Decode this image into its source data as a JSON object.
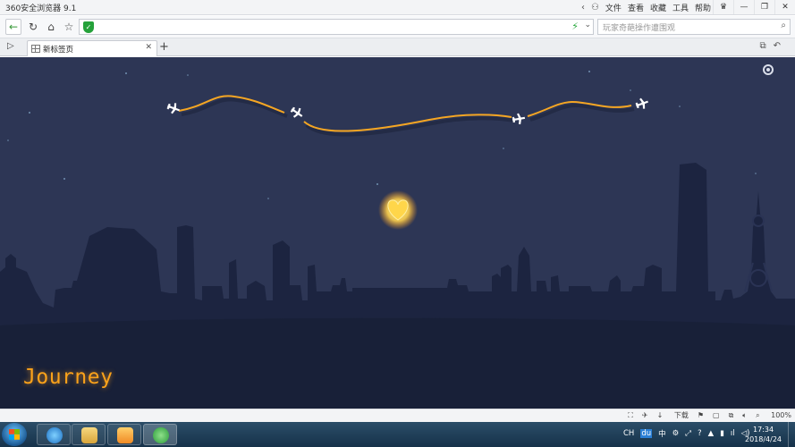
{
  "window": {
    "title": "360安全浏览器 9.1"
  },
  "menu": {
    "items": [
      "文件",
      "查看",
      "收藏",
      "工具",
      "帮助"
    ]
  },
  "address": {
    "url": ""
  },
  "search": {
    "placeholder": "玩家奇葩操作遭围观"
  },
  "tab": {
    "title": "新标签页"
  },
  "page": {
    "brand": "Journey"
  },
  "statusbar": {
    "download": "下载",
    "zoom": "100%"
  },
  "taskbar": {
    "tray": {
      "lang": "CH",
      "ime": "中"
    },
    "clock": {
      "time": "17:34",
      "date": "2018/4/24"
    }
  },
  "colors": {
    "sky": "#2d3655",
    "skyline": "#1c2440",
    "trail": "#f5a623",
    "heart": "#ffd24d"
  }
}
